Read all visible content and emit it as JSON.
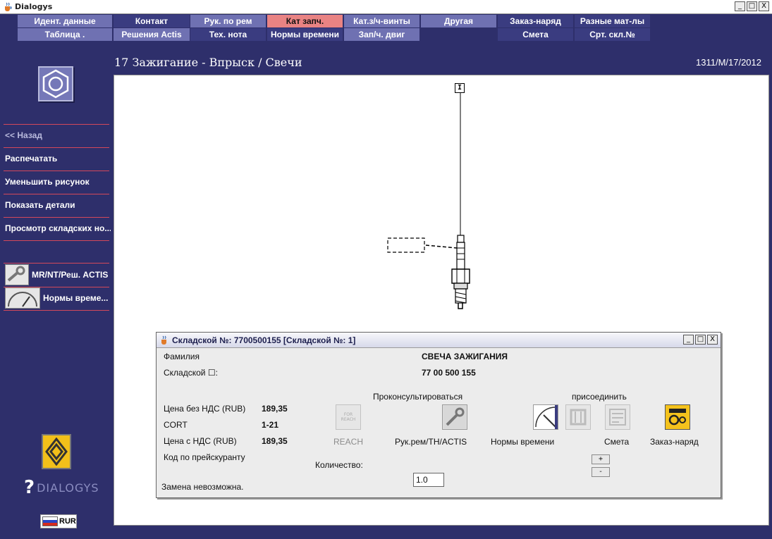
{
  "window": {
    "title": "Dialogys",
    "controls": {
      "minimize": "_",
      "maximize": "□",
      "close": "X"
    }
  },
  "menu": {
    "row1": [
      {
        "label": "Идент. данные",
        "state": "light"
      },
      {
        "label": "Контакт",
        "state": "dark"
      },
      {
        "label": "Рук. по рем",
        "state": "light"
      },
      {
        "label": "Кат запч.",
        "state": "active"
      },
      {
        "label": "Кат.з/ч-винты",
        "state": "light"
      },
      {
        "label": "Другая",
        "state": "light"
      },
      {
        "label": "Заказ-наряд",
        "state": "dark"
      },
      {
        "label": "Разные мат-лы",
        "state": "dark"
      }
    ],
    "row2": [
      {
        "label": "Таблица .",
        "state": "light"
      },
      {
        "label": "Решения Actis",
        "state": "light"
      },
      {
        "label": "Тех. нота",
        "state": "dark"
      },
      {
        "label": "Нормы времени",
        "state": "dark"
      },
      {
        "label": "Зап/ч. двиг",
        "state": "light"
      },
      {
        "label": "Смета",
        "state": "dark"
      },
      {
        "label": "Срт. скл.№",
        "state": "dark"
      }
    ]
  },
  "header": {
    "page_title": "17 Зажигание - Впрыск / Свечи",
    "ref_code": "1311/M/17/2012"
  },
  "sidebar": {
    "back": "<< Назад",
    "print": "Распечатать",
    "reduce": "Уменьшить рисунок",
    "show_details": "Показать детали",
    "view_stock": "Просмотр складских но...",
    "mr_link": "MR/NT/Реш. ACTIS",
    "time_link": "Нормы време...",
    "brand": "DIALOGYS",
    "currency": "RUR"
  },
  "drawing": {
    "ref_marker": "I"
  },
  "dialog": {
    "title": "Складской №: 7700500155 [Складской №: 1]",
    "family_label": "Фамилия",
    "family_value": "СВЕЧА ЗАЖИГАНИЯ",
    "stock_label": "Складской ☐:",
    "stock_value": "77 00 500 155",
    "consult_label": "Проконсультироваться",
    "attach_label": "присоединить",
    "price_excl_label": "Цена без НДС (RUB)",
    "price_excl_value": "189,35",
    "cort_label": "CORT",
    "cort_value": "1-21",
    "price_incl_label": "Цена с НДС (RUB)",
    "price_incl_value": "189,35",
    "price_code_label": "Код по прейскуранту",
    "reach_label": "REACH",
    "reach_icon_text": "FOR REACH",
    "repair_label": "Рук.рем/TH/ACTIS",
    "time_label": "Нормы времени",
    "estimate_label": "Смета",
    "order_label": "Заказ-наряд",
    "qty_label": "Количество:",
    "qty_value": "1.0",
    "plus": "+",
    "minus": "-",
    "status": "Замена невозможна."
  }
}
